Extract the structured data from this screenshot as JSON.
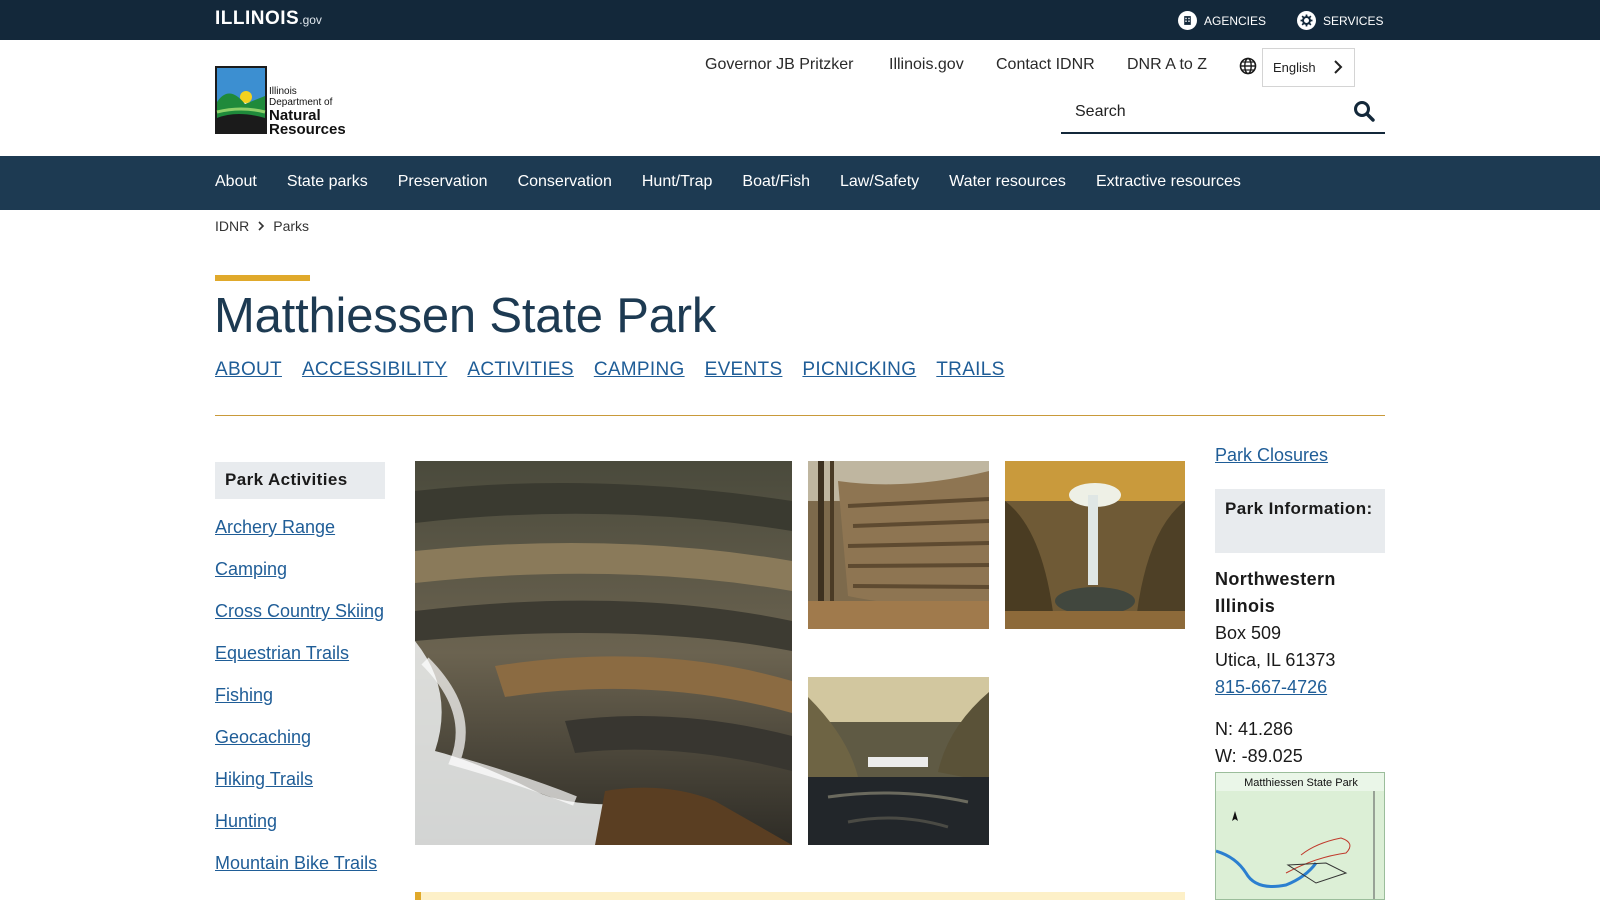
{
  "topbar": {
    "logo_main": "ILLINOIS",
    "logo_suffix": ".gov",
    "agencies_label": "AGENCIES",
    "services_label": "SERVICES"
  },
  "header": {
    "logo_lines": [
      "Illinois",
      "Department of",
      "Natural",
      "Resources"
    ],
    "links": [
      "Governor JB Pritzker",
      "Illinois.gov",
      "Contact IDNR",
      "DNR A to Z"
    ],
    "language": "English",
    "search_placeholder": "Search"
  },
  "main_nav": [
    "About",
    "State parks",
    "Preservation",
    "Conservation",
    "Hunt/Trap",
    "Boat/Fish",
    "Law/Safety",
    "Water resources",
    "Extractive resources"
  ],
  "breadcrumb": [
    "IDNR",
    "Parks"
  ],
  "page": {
    "title": "Matthiessen State Park",
    "subnav": [
      "ABOUT",
      "ACCESSIBILITY",
      "ACTIVITIES",
      "CAMPING",
      "EVENTS",
      "PICNICKING",
      "TRAILS"
    ]
  },
  "sidebar": {
    "heading": "Park Activities",
    "items": [
      "Archery Range",
      "Camping",
      "Cross Country Skiing",
      "Equestrian Trails",
      "Fishing",
      "Geocaching",
      "Hiking Trails",
      "Hunting",
      "Mountain Bike Trails"
    ]
  },
  "info": {
    "closures_link": "Park Closures",
    "heading": "Park Information:",
    "region": "Northwestern Illinois",
    "address1": "Box 509",
    "address2": "Utica, IL 61373",
    "phone": "815-667-4726",
    "lat": "N: 41.286",
    "lon": "W: -89.025",
    "map_title": "Matthiessen State Park"
  },
  "colors": {
    "topbar": "#13283a",
    "nav": "#1d3a52",
    "accent_gold": "#e0a92b",
    "link_blue": "#1f5d97"
  }
}
